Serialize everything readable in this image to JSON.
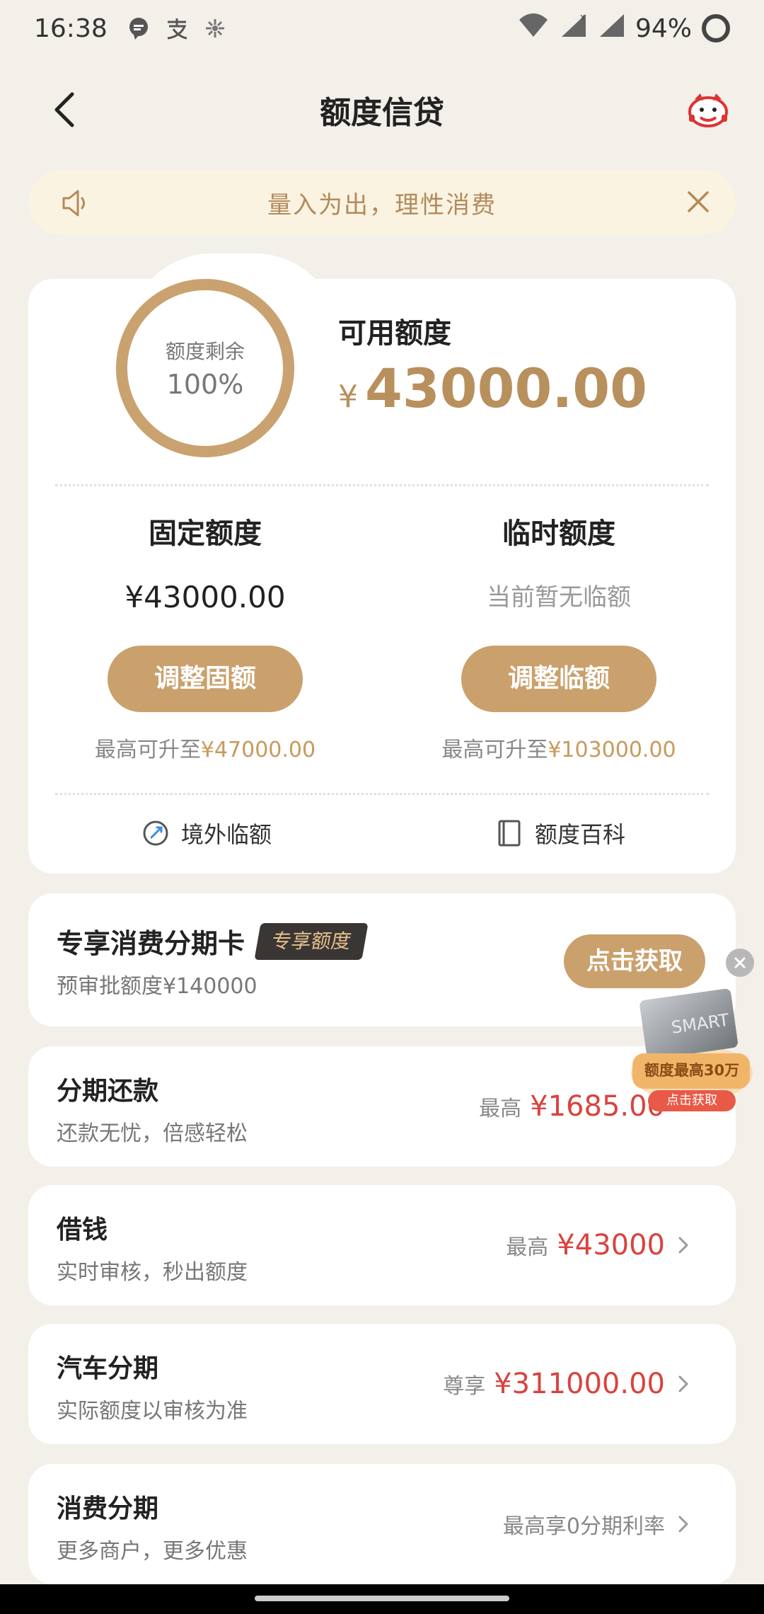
{
  "status_bar": {
    "time": "16:38",
    "battery": "94%"
  },
  "nav": {
    "title": "额度信贷"
  },
  "notice": {
    "text": "量入为出，理性消费"
  },
  "quota": {
    "ring_label": "额度剩余",
    "ring_value": "100%",
    "ring_fraction": 1.0,
    "available_label": "可用额度",
    "available_symbol": "¥",
    "available_amount": "43000.00",
    "fixed": {
      "title": "固定额度",
      "value": "¥43000.00",
      "button": "调整固额",
      "foot_prefix": "最高可升至",
      "foot_amount": "¥47000.00"
    },
    "temp": {
      "title": "临时额度",
      "value": "当前暂无临额",
      "button": "调整临额",
      "foot_prefix": "最高可升至",
      "foot_amount": "¥103000.00"
    },
    "links": {
      "overseas": "境外临额",
      "wiki": "额度百科"
    }
  },
  "promo": {
    "title": "专享消费分期卡",
    "badge": "专享额度",
    "sub": "预审批额度¥140000",
    "button": "点击获取"
  },
  "float_ad": {
    "text": "额度最高30万",
    "button": "点击获取",
    "card_text": "SMART"
  },
  "list": [
    {
      "title": "分期还款",
      "sub": "还款无忧，倍感轻松",
      "prefix": "最高",
      "amount": "¥1685.00"
    },
    {
      "title": "借钱",
      "sub": "实时审核，秒出额度",
      "prefix": "最高",
      "amount": "¥43000"
    },
    {
      "title": "汽车分期",
      "sub": "实际额度以审核为准",
      "prefix": "尊享",
      "amount": "¥311000.00"
    },
    {
      "title": "消费分期",
      "sub": "更多商户，更多优惠",
      "plain": "最高享0分期利率"
    }
  ],
  "colors": {
    "gold": "#caa06c",
    "accent_red": "#d9433f",
    "notice_bg": "#fbf3e1",
    "page_bg": "#f3efe9"
  }
}
